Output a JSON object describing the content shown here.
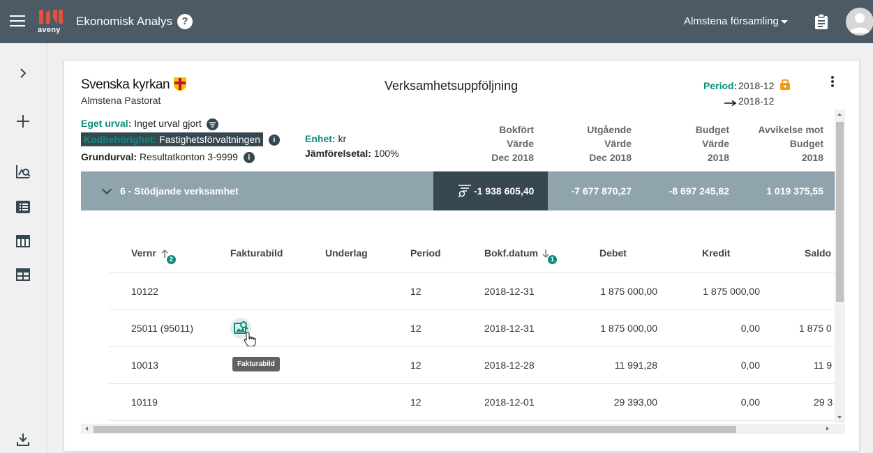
{
  "header": {
    "logo_text": "aveny",
    "app_title": "Ekonomisk Analys",
    "help_symbol": "?",
    "org_selector": "Almstena församling",
    "colors": {
      "topbar": "#4c5a66",
      "accent": "#0e8b7e",
      "dark": "#37474f",
      "group": "#90a4ae"
    }
  },
  "rail": {
    "icons": [
      "chevron-right-icon",
      "plus-icon",
      "analytics-icon",
      "list-icon",
      "table-icon",
      "grid-table-icon",
      "download-icon"
    ]
  },
  "report": {
    "brand": "Svenska kyrkan",
    "sub_org": "Almstena Pastorat",
    "title": "Verksamhetsuppföljning",
    "period_label": "Period:",
    "period_from": "2018-12",
    "period_to": "2018-12",
    "eget_urval_label": "Eget urval:",
    "eget_urval_value": "Inget urval gjort",
    "kod_label": "Kodbehörighet:",
    "kod_value": "Fastighetsförvaltningen",
    "grundurval_label": "Grundurval:",
    "grundurval_value": "Resultatkonton 3-9999",
    "enhet_label": "Enhet:",
    "enhet_value": "kr",
    "jamf_label": "Jämförelsetal:",
    "jamf_value": "100%",
    "info_symbol": "i"
  },
  "summary_columns": [
    {
      "l1": "Bokfört",
      "l2": "Värde",
      "l3": "Dec 2018"
    },
    {
      "l1": "Utgående",
      "l2": "Värde",
      "l3": "Dec 2018"
    },
    {
      "l1": "Budget",
      "l2": "Värde",
      "l3": "2018"
    },
    {
      "l1": "Avvikelse mot",
      "l2": "Budget",
      "l3": "2018"
    }
  ],
  "group_row": {
    "label": "6 - Stödjande verksamhet",
    "bokfort": "-1 938 605,40",
    "utgaende": "-7 677 870,27",
    "budget": "-8 697 245,82",
    "avvikelse": "1 019 375,55"
  },
  "table": {
    "headers": {
      "vernr": "Vernr",
      "fakturabild": "Fakturabild",
      "underlag": "Underlag",
      "period": "Period",
      "bokfdatum": "Bokf.datum",
      "debet": "Debet",
      "kredit": "Kredit",
      "saldo": "Saldo"
    },
    "sort_badges": {
      "vernr": "2",
      "bokfdatum": "1"
    },
    "rows": [
      {
        "vernr": "10122",
        "period": "12",
        "datum": "2018-12-31",
        "debet": "1 875 000,00",
        "kredit": "1 875 000,00",
        "saldo": ""
      },
      {
        "vernr": "25011 (95011)",
        "period": "12",
        "datum": "2018-12-31",
        "debet": "1 875 000,00",
        "kredit": "0,00",
        "saldo": "1 875 0"
      },
      {
        "vernr": "10013",
        "period": "12",
        "datum": "2018-12-28",
        "debet": "11 991,28",
        "kredit": "0,00",
        "saldo": "11 9"
      },
      {
        "vernr": "10119",
        "period": "12",
        "datum": "2018-12-01",
        "debet": "29 393,00",
        "kredit": "0,00",
        "saldo": "29 3"
      }
    ]
  },
  "tooltip": {
    "text": "Fakturabild"
  }
}
